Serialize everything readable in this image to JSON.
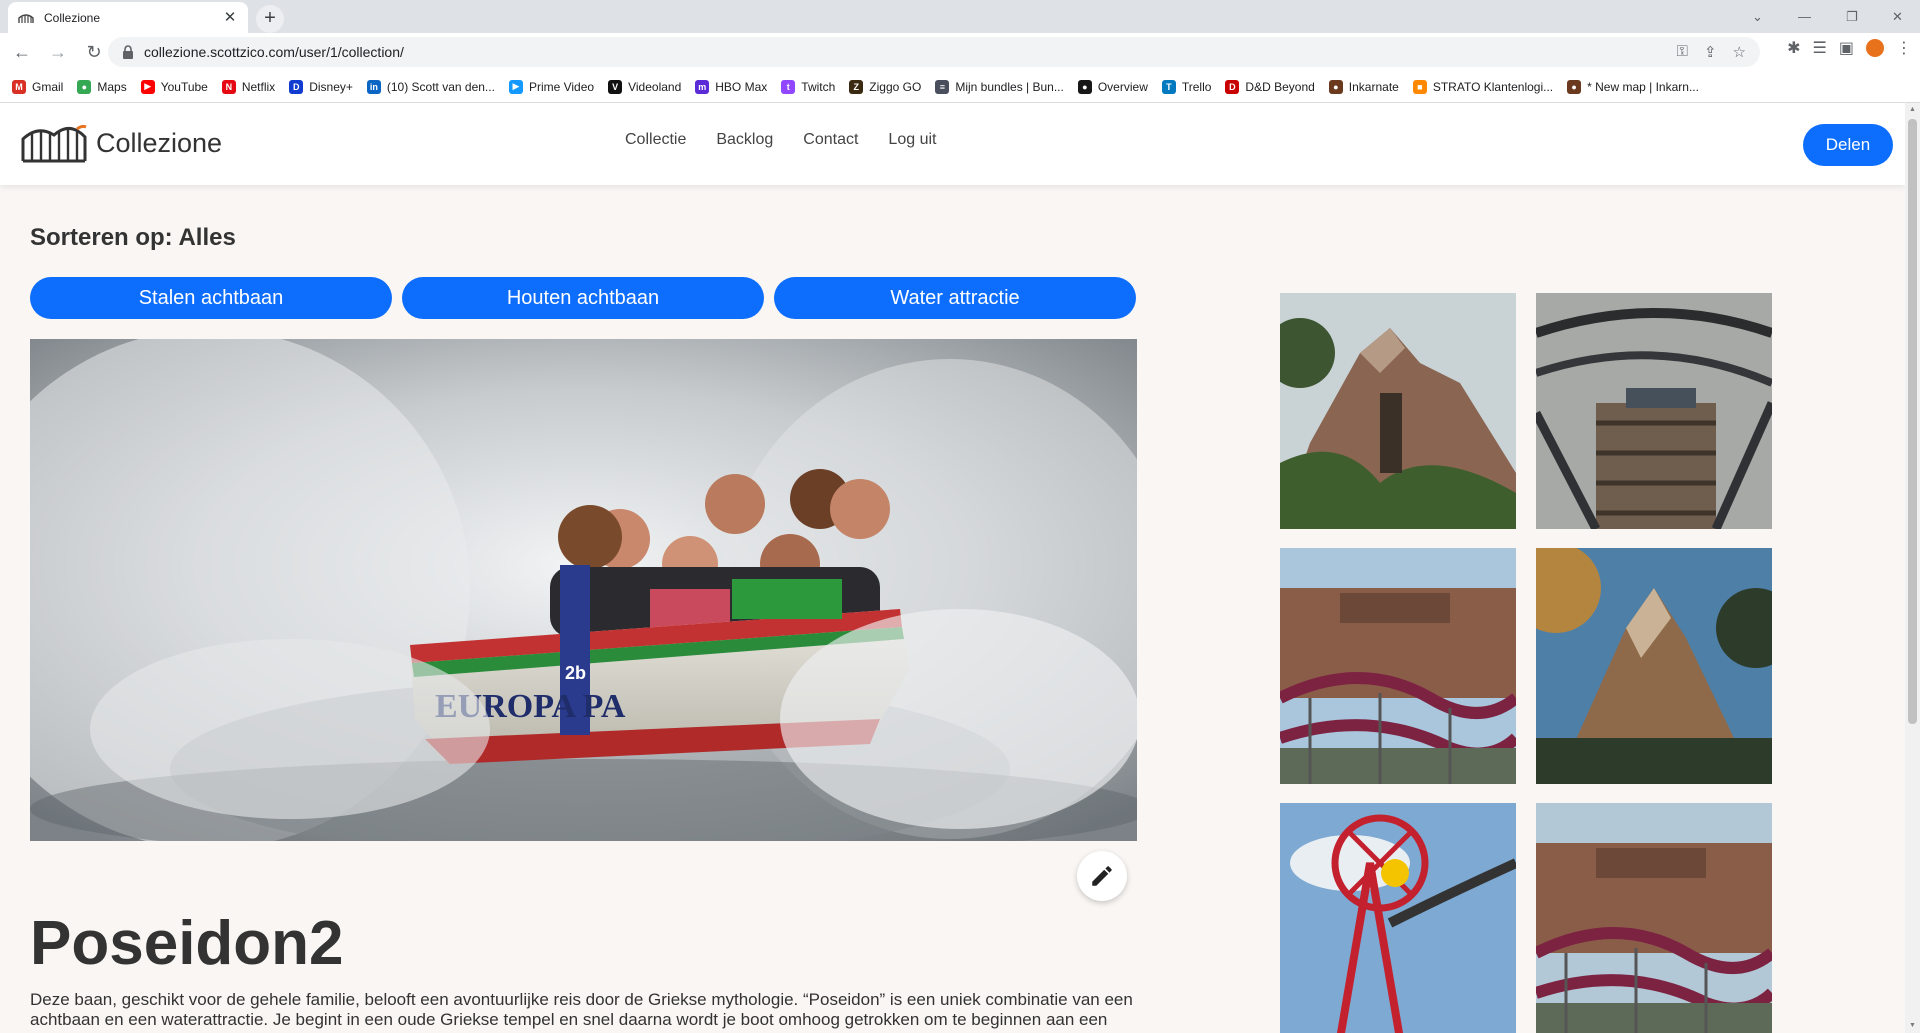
{
  "browser": {
    "tab_title": "Collezione",
    "url": "collezione.scottzico.com/user/1/collection/",
    "bookmarks": [
      {
        "label": "Gmail",
        "icon": "gmail-icon",
        "color": "#d93025",
        "glyph": "M"
      },
      {
        "label": "Maps",
        "icon": "maps-icon",
        "color": "#34a853",
        "glyph": "●"
      },
      {
        "label": "YouTube",
        "icon": "youtube-icon",
        "color": "#ff0000",
        "glyph": "▶"
      },
      {
        "label": "Netflix",
        "icon": "netflix-icon",
        "color": "#e50914",
        "glyph": "N"
      },
      {
        "label": "Disney+",
        "icon": "disney-icon",
        "color": "#113ccf",
        "glyph": "D"
      },
      {
        "label": "(10) Scott van den...",
        "icon": "linkedin-icon",
        "color": "#0a66c2",
        "glyph": "in"
      },
      {
        "label": "Prime Video",
        "icon": "prime-video-icon",
        "color": "#1399ff",
        "glyph": "▶"
      },
      {
        "label": "Videoland",
        "icon": "videoland-icon",
        "color": "#111111",
        "glyph": "V"
      },
      {
        "label": "HBO Max",
        "icon": "hbo-max-icon",
        "color": "#5a2bd6",
        "glyph": "m"
      },
      {
        "label": "Twitch",
        "icon": "twitch-icon",
        "color": "#9146ff",
        "glyph": "t"
      },
      {
        "label": "Ziggo GO",
        "icon": "ziggo-icon",
        "color": "#3a2a12",
        "glyph": "Z"
      },
      {
        "label": "Mijn bundles | Bun...",
        "icon": "humble-icon",
        "color": "#494f5c",
        "glyph": "≡"
      },
      {
        "label": "Overview",
        "icon": "github-icon",
        "color": "#181717",
        "glyph": "●"
      },
      {
        "label": "Trello",
        "icon": "trello-icon",
        "color": "#0079bf",
        "glyph": "T"
      },
      {
        "label": "D&D Beyond",
        "icon": "dnd-beyond-icon",
        "color": "#c90000",
        "glyph": "D"
      },
      {
        "label": "Inkarnate",
        "icon": "inkarnate-icon",
        "color": "#6b3a1e",
        "glyph": "●"
      },
      {
        "label": "STRATO Klantenlogi...",
        "icon": "strato-icon",
        "color": "#ff8800",
        "glyph": "■"
      },
      {
        "label": "* New map | Inkarn...",
        "icon": "inkarnate-icon",
        "color": "#6b3a1e",
        "glyph": "●"
      }
    ]
  },
  "site": {
    "brand": "Collezione",
    "nav": [
      "Collectie",
      "Backlog",
      "Contact",
      "Log uit"
    ],
    "share_label": "Delen",
    "accent": "#0d6efd"
  },
  "sort": {
    "title": "Sorteren op: Alles",
    "filters": [
      "Stalen achtbaan",
      "Houten achtbaan",
      "Water attractie"
    ]
  },
  "ride": {
    "title": "Poseidon2",
    "boat_text": "EUROPA PA",
    "boat_number": "2b",
    "description": "Deze baan, geschikt voor de gehele familie, belooft een avontuurlijke reis door de Griekse mythologie. “Poseidon” is een uniek combinatie van een achtbaan en een waterattractie. Je begint in een oude Griekse tempel en snel daarna wordt je boot omhoog getrokken om te beginnen aan een"
  },
  "gallery": [
    "mountain-coaster",
    "wooden-coaster",
    "steel-coaster-station",
    "rocky-mountain",
    "red-tower-coaster",
    "steel-coaster-station"
  ]
}
